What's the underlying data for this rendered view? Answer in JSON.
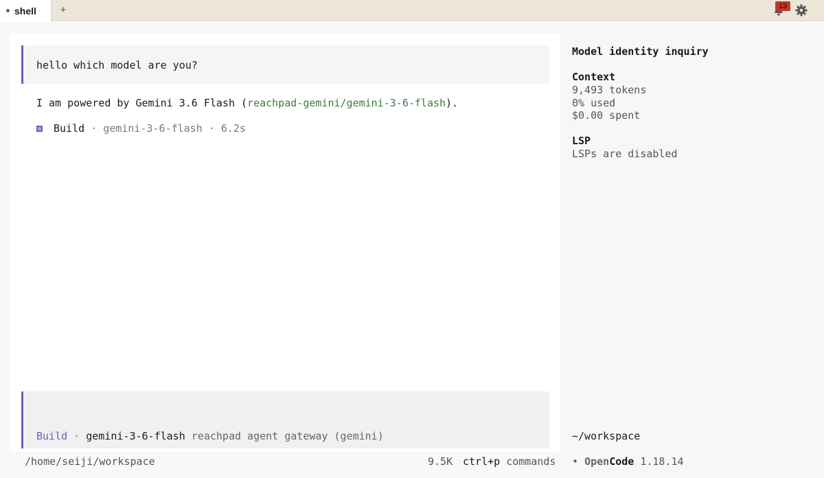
{
  "tabbar": {
    "tab_label": "shell",
    "add_label": "+",
    "notification_count": "13"
  },
  "conversation": {
    "user_message": "hello which model are you?",
    "reply_prefix": "I am powered by Gemini 3.6 Flash (",
    "reply_code": "reachpad-gemini/gemini-3-6-flash",
    "reply_suffix": ").",
    "build": {
      "mode": "Build",
      "sep1": " · ",
      "model": "gemini-3-6-flash",
      "sep2": " · ",
      "duration": "6.2s"
    }
  },
  "input": {
    "mode": "Build",
    "sep": " · ",
    "model": "gemini-3-6-flash",
    "gateway": " reachpad agent gateway (gemini)"
  },
  "footer": {
    "path": "/home/seiji/workspace",
    "tokens": "9.5K",
    "shortcut": "ctrl+p",
    "shortcut_label": " commands"
  },
  "sidebar": {
    "title": "Model identity inquiry",
    "context_heading": "Context",
    "context_tokens": "9,493 tokens",
    "context_used": "0% used",
    "context_spent": "$0.00 spent",
    "lsp_heading": "LSP",
    "lsp_status": "LSPs are disabled",
    "workspace": "~/workspace",
    "version_bullet": "•",
    "brand_open": "Open",
    "brand_code": "Code",
    "version": "1.18.14"
  },
  "colors": {
    "accent": "#7b56b8",
    "code_green": "#3d7a3d",
    "badge_red": "#c0392b",
    "tabbar_bg": "#ece6d8"
  },
  "icons": {
    "bell": "bell-icon",
    "gear": "gear-icon",
    "build": "build-square-icon"
  }
}
